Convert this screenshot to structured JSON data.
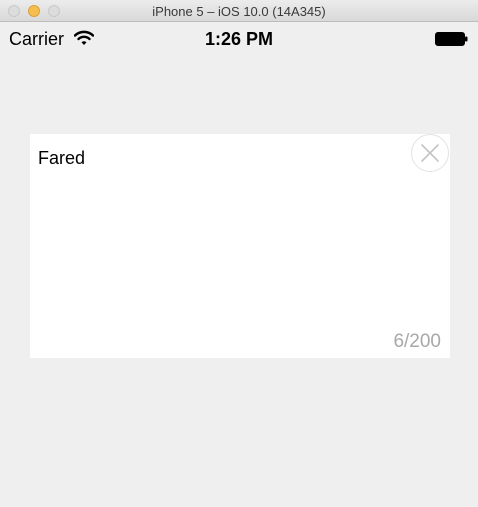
{
  "window": {
    "title": "iPhone 5 – iOS 10.0 (14A345)"
  },
  "status_bar": {
    "carrier": "Carrier",
    "time": "1:26 PM",
    "icons": [
      "wifi-icon",
      "battery-icon"
    ]
  },
  "card": {
    "text": "Fared",
    "counter": "6/200",
    "clear_icon": "close-icon"
  },
  "colors": {
    "background": "#efefef",
    "card": "#ffffff",
    "counter_text": "#a8a8a8",
    "minimize_button": "#f5be4f"
  }
}
